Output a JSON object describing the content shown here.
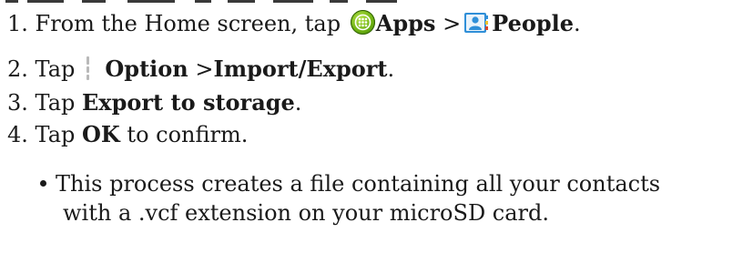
{
  "steps": [
    {
      "number": "1.",
      "text_before": "From the Home screen, tap",
      "apps_label": "Apps",
      "separator": ">",
      "people_label": "People",
      "end": ".",
      "icons": [
        "apps-icon",
        "people-icon"
      ]
    },
    {
      "number": "2.",
      "text_before": "Tap",
      "option_label": "Option",
      "separator": ">",
      "import_export_label": "Import/Export",
      "end": ".",
      "icons": [
        "menu-icon"
      ]
    },
    {
      "number": "3.",
      "text_before": "Tap",
      "action_label": "Export to storage",
      "end": "."
    },
    {
      "number": "4.",
      "text_before": "Tap",
      "action_label": "OK",
      "text_after": "to confirm."
    }
  ],
  "note": {
    "line1": "This process creates a file containing all your contacts",
    "line2": "with a .vcf extension on your microSD card."
  },
  "colors": {
    "text": "#1a1a1a",
    "apps_icon": "#6fb312",
    "people_icon_blue": "#2f8fd8"
  }
}
